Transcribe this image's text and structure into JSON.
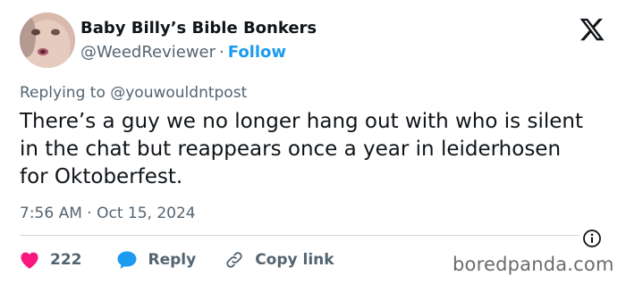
{
  "author": {
    "display_name": "Baby Billy’s Bible Bonkers",
    "handle": "@WeedReviewer",
    "separator": "·",
    "follow_label": "Follow"
  },
  "tweet": {
    "replying_to": "Replying to @youwouldntpost",
    "text": "There’s a guy we no longer hang out with who is silent in the chat but reappears once a year in leiderhosen for Oktoberfest.",
    "timestamp": "7:56 AM · Oct 15, 2024"
  },
  "actions": {
    "like_count": "222",
    "reply_label": "Reply",
    "copy_link_label": "Copy link"
  },
  "icons": {
    "brand": "x-logo-icon",
    "info": "info-icon",
    "like": "heart-icon",
    "reply": "speech-bubble-icon",
    "copy_link": "link-icon"
  },
  "colors": {
    "like": "#f91880",
    "reply": "#1d9bf0",
    "follow": "#1d9bf0",
    "secondary_text": "#536471",
    "primary_text": "#0f1419"
  },
  "watermark": "boredpanda.com"
}
